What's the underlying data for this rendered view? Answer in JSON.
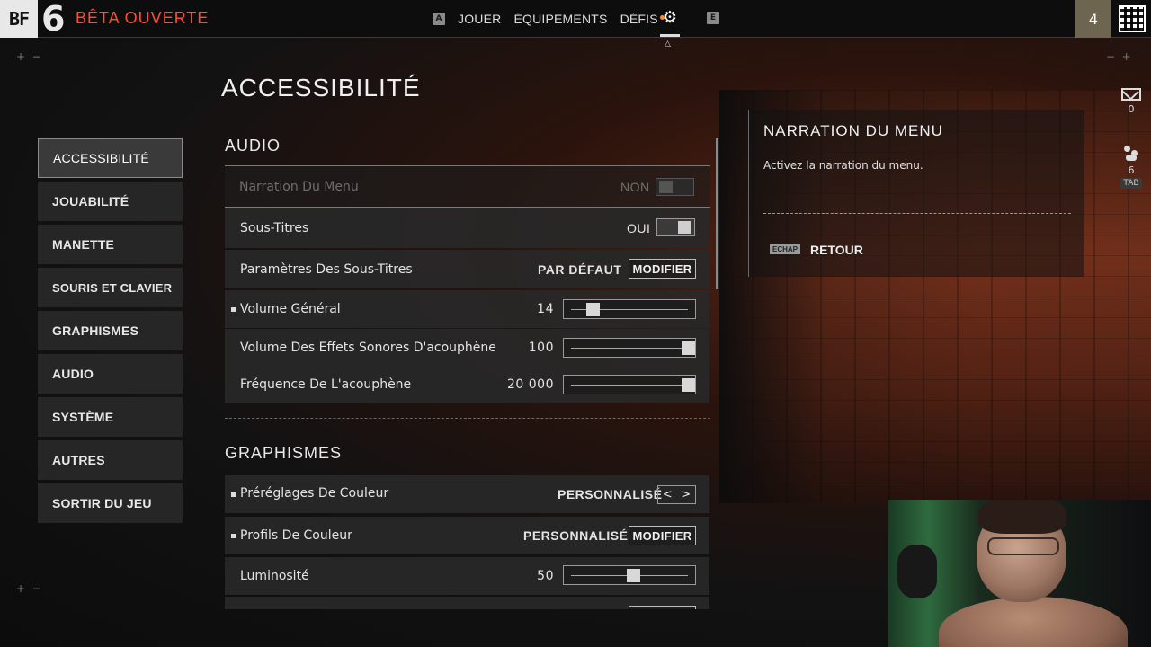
{
  "colors": {
    "accent_red": "#ff4b3a",
    "notify_dot": "#ff8a2a",
    "level_bg": "#6e6550"
  },
  "topbar": {
    "logo_letters": "BF",
    "logo_number": "6",
    "beta_label": "BÊTA OUVERTE",
    "key_left": "A",
    "key_right": "E",
    "nav": [
      "JOUER",
      "ÉQUIPEMENTS",
      "DÉFIS"
    ],
    "settings_icon": "gear-icon",
    "level": "4"
  },
  "page_title": "ACCESSIBILITÉ",
  "sidebar": {
    "items": [
      {
        "label": "ACCESSIBILITÉ",
        "active": true
      },
      {
        "label": "JOUABILITÉ"
      },
      {
        "label": "MANETTE"
      },
      {
        "label": "SOURIS ET CLAVIER"
      },
      {
        "label": "GRAPHISMES"
      },
      {
        "label": "AUDIO"
      },
      {
        "label": "SYSTÈME"
      },
      {
        "label": "AUTRES"
      },
      {
        "label": "SORTIR DU JEU"
      }
    ]
  },
  "audio": {
    "title": "AUDIO",
    "menu_narration": {
      "label": "Narration Du Menu",
      "value": "NON"
    },
    "subtitles": {
      "label": "Sous-Titres",
      "value": "OUI"
    },
    "subtitle_settings": {
      "label": "Paramètres Des Sous-Titres",
      "value": "PAR DÉFAUT",
      "button": "MODIFIER"
    },
    "master_volume": {
      "label": "Volume Général",
      "value": "14",
      "level_percent": 14
    },
    "tinnitus_volume": {
      "label": "Volume Des Effets Sonores D'acouphène",
      "value": "100",
      "level_percent": 100
    },
    "tinnitus_freq": {
      "label": "Fréquence De L'acouphène",
      "value": "20 000",
      "level_percent": 100
    }
  },
  "graphics": {
    "title": "GRAPHISMES",
    "color_presets": {
      "label": "Préréglages De Couleur",
      "value": "PERSONNALISÉ",
      "prev": "<",
      "next": ">"
    },
    "color_profiles": {
      "label": "Profils De Couleur",
      "value": "PERSONNALISÉ",
      "button": "MODIFIER"
    },
    "brightness": {
      "label": "Luminosité",
      "value": "50",
      "level_percent": 50
    }
  },
  "info_panel": {
    "title": "NARRATION DU MENU",
    "description": "Activez la narration du menu.",
    "back_key": "ECHAP",
    "back_label": "RETOUR"
  },
  "status": {
    "mail_count": "0",
    "friends_count": "6",
    "tab_key": "TAB"
  }
}
